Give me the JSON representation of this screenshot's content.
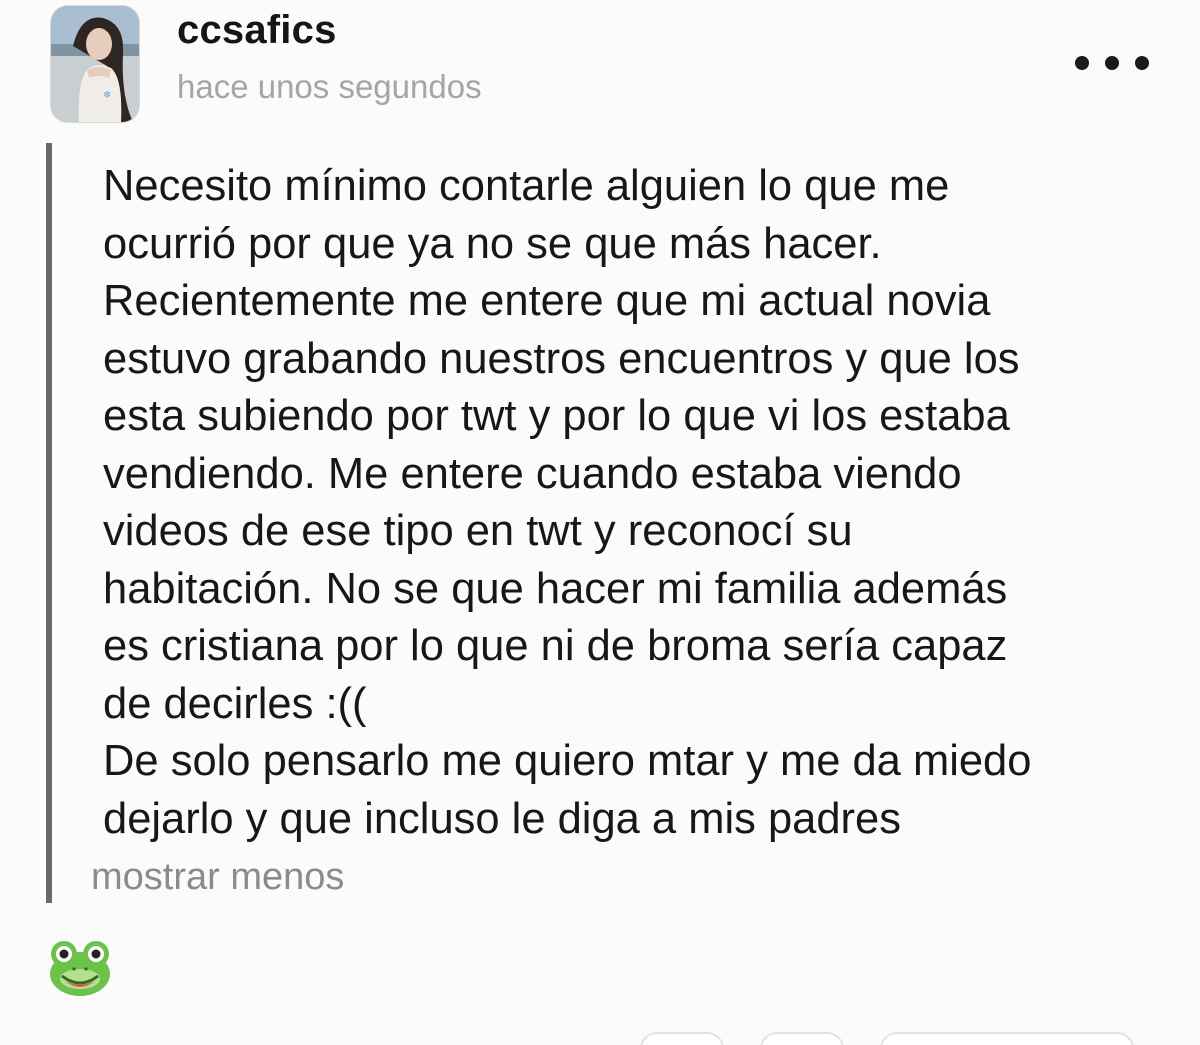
{
  "post": {
    "username": "ccsafics",
    "timestamp": "hace unos segundos",
    "body_lines": [
      "Necesito mínimo contarle alguien lo que me",
      "ocurrió por que ya no se que más hacer.",
      "Recientemente me entere que mi actual novia",
      "estuvo grabando nuestros encuentros y que los",
      "esta subiendo por twt y por lo que vi los estaba",
      "vendiendo. Me entere cuando estaba viendo",
      "videos de ese tipo en twt y reconocí su",
      "habitación. No se que hacer mi familia además",
      "es cristiana por lo que ni de broma sería capaz",
      "de decirles :((",
      "De solo pensarlo me quiero mtar y me da miedo",
      "dejarlo y que incluso le diga a mis padres"
    ],
    "show_less_label": "mostrar menos",
    "reaction_icon": "frog-icon",
    "more_icon": "ellipsis-icon",
    "avatar_icon": "avatar-photo"
  },
  "colors": {
    "text": "#171717",
    "muted": "#a5a5a5",
    "link_muted": "#8b8b8b",
    "quote_bar": "#6a6a6a"
  }
}
